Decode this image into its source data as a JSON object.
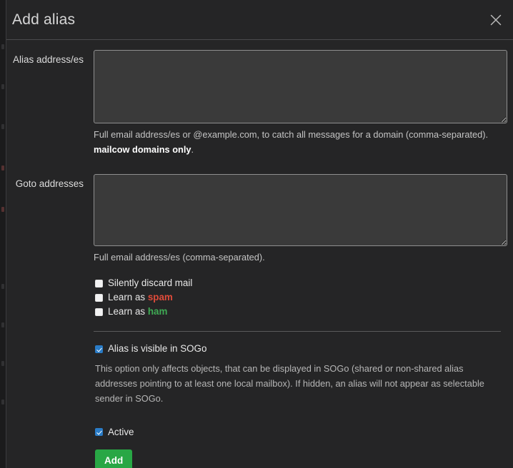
{
  "modal": {
    "title": "Add alias",
    "close_icon": "close-icon"
  },
  "form": {
    "alias": {
      "label": "Alias address/es",
      "value": "",
      "placeholder": "",
      "help_prefix": "Full email address/es or @example.com, to catch all messages for a domain (comma-separated). ",
      "help_bold": "mailcow domains only",
      "help_suffix": "."
    },
    "goto": {
      "label": "Goto addresses",
      "value": "",
      "placeholder": "",
      "help": "Full email address/es (comma-separated)."
    },
    "options": [
      {
        "name": "silent-discard",
        "label": "Silently discard mail",
        "checked": false
      },
      {
        "name": "learn-spam",
        "label_prefix": "Learn as ",
        "label_accent": "spam",
        "accent_class": "spam",
        "checked": false
      },
      {
        "name": "learn-ham",
        "label_prefix": "Learn as ",
        "label_accent": "ham",
        "accent_class": "ham",
        "checked": false
      }
    ],
    "sogo": {
      "label": "Alias is visible in SOGo",
      "checked": true,
      "description": "This option only affects objects, that can be displayed in SOGo (shared or non-shared alias addresses pointing to at least one local mailbox). If hidden, an alias will not appear as selectable sender in SOGo."
    },
    "active": {
      "label": "Active",
      "checked": true
    },
    "submit_label": "Add"
  },
  "colors": {
    "accent_green": "#28a745",
    "accent_blue": "#2a7cc7",
    "spam_red": "#e04b3a",
    "ham_green": "#3faa54",
    "modal_bg": "#252526"
  }
}
